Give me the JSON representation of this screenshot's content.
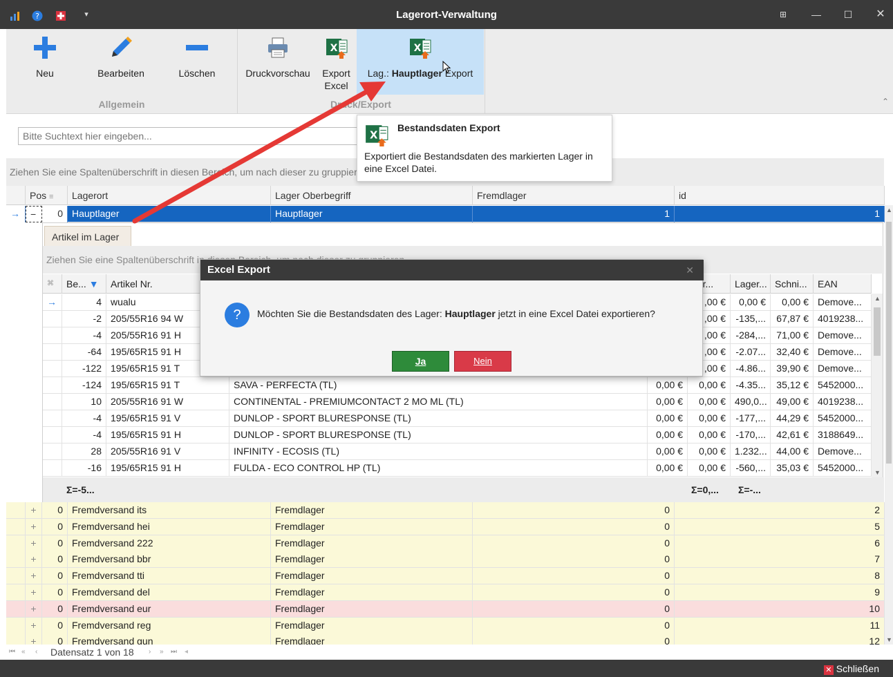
{
  "window": {
    "title": "Lagerort-Verwaltung"
  },
  "ribbon": {
    "new_label": "Neu",
    "edit_label": "Bearbeiten",
    "delete_label": "Löschen",
    "print_preview_label": "Druckvorschau",
    "export_excel_label_1": "Export",
    "export_excel_label_2": "Excel",
    "lag_export_prefix": "Lag.: ",
    "lag_export_name": "Hauptlager",
    "lag_export_suffix": " Export",
    "group_general": "Allgemein",
    "group_print_export": "Druck/Export"
  },
  "search": {
    "placeholder": "Bitte Suchtext hier eingeben..."
  },
  "grouping_hint": "Ziehen Sie eine Spaltenüberschrift in diesen Bereich, um nach dieser zu gruppieren",
  "grid": {
    "columns": [
      "Pos",
      "Lagerort",
      "Lager Oberbegriff",
      "Fremdlager",
      "id"
    ],
    "selected_row": {
      "toggle": "−",
      "pos": "0",
      "lagerort": "Hauptlager",
      "oberbegriff": "Hauptlager",
      "fremdlager": "1",
      "id": "1"
    },
    "rows": [
      {
        "toggle": "+",
        "pos": "0",
        "lagerort": "Fremdversand its",
        "oberbegriff": "Fremdlager",
        "fremdlager": "0",
        "id": "2"
      },
      {
        "toggle": "+",
        "pos": "0",
        "lagerort": "Fremdversand hei",
        "oberbegriff": "Fremdlager",
        "fremdlager": "0",
        "id": "5"
      },
      {
        "toggle": "+",
        "pos": "0",
        "lagerort": "Fremdversand 222",
        "oberbegriff": "Fremdlager",
        "fremdlager": "0",
        "id": "6"
      },
      {
        "toggle": "+",
        "pos": "0",
        "lagerort": "Fremdversand bbr",
        "oberbegriff": "Fremdlager",
        "fremdlager": "0",
        "id": "7"
      },
      {
        "toggle": "+",
        "pos": "0",
        "lagerort": "Fremdversand tti",
        "oberbegriff": "Fremdlager",
        "fremdlager": "0",
        "id": "8"
      },
      {
        "toggle": "+",
        "pos": "0",
        "lagerort": "Fremdversand del",
        "oberbegriff": "Fremdlager",
        "fremdlager": "0",
        "id": "9"
      },
      {
        "toggle": "+",
        "pos": "0",
        "lagerort": "Fremdversand eur",
        "oberbegriff": "Fremdlager",
        "fremdlager": "0",
        "id": "10"
      },
      {
        "toggle": "+",
        "pos": "0",
        "lagerort": "Fremdversand reg",
        "oberbegriff": "Fremdlager",
        "fremdlager": "0",
        "id": "11"
      },
      {
        "toggle": "+",
        "pos": "0",
        "lagerort": "Fremdversand gun",
        "oberbegriff": "Fremdlager",
        "fremdlager": "0",
        "id": "12"
      }
    ]
  },
  "detail": {
    "tab_label": "Artikel im Lager",
    "grouping_hint": "Ziehen Sie eine Spaltenüberschrift in diesen Bereich, um nach dieser zu gruppieren",
    "columns": [
      "Be...",
      "Artikel Nr.",
      "ger...",
      "Lager...",
      "Schni...",
      "EAN"
    ],
    "rows": [
      {
        "be": "4",
        "artnr": "wualu",
        "bez": "",
        "ek": "",
        "ger": ",00 €",
        "lager": "0,00 €",
        "schni": "0,00 €",
        "ean": "Demove..."
      },
      {
        "be": "-2",
        "artnr": "205/55R16 94 W",
        "bez": "",
        "ek": "",
        "ger": ",00 €",
        "lager": "-135,...",
        "schni": "67,87 €",
        "ean": "4019238..."
      },
      {
        "be": "-4",
        "artnr": "205/55R16 91 H",
        "bez": "",
        "ek": "",
        "ger": ",00 €",
        "lager": "-284,...",
        "schni": "71,00 €",
        "ean": "Demove..."
      },
      {
        "be": "-64",
        "artnr": "195/65R15 91 H",
        "bez": "",
        "ek": "",
        "ger": ",00 €",
        "lager": "-2.07...",
        "schni": "32,40 €",
        "ean": "Demove..."
      },
      {
        "be": "-122",
        "artnr": "195/65R15 91 T",
        "bez": "",
        "ek": "",
        "ger": ",00 €",
        "lager": "-4.86...",
        "schni": "39,90 €",
        "ean": "Demove..."
      },
      {
        "be": "-124",
        "artnr": "195/65R15 91 T",
        "bez": "SAVA - PERFECTA (TL)",
        "ek": "0,00 €",
        "ger": "0,00 €",
        "lager": "-4.35...",
        "schni": "35,12 €",
        "ean": "5452000..."
      },
      {
        "be": "10",
        "artnr": "205/55R16 91 W",
        "bez": "CONTINENTAL - PREMIUMCONTACT 2 MO ML (TL)",
        "ek": "0,00 €",
        "ger": "0,00 €",
        "lager": "490,0...",
        "schni": "49,00 €",
        "ean": "4019238..."
      },
      {
        "be": "-4",
        "artnr": "195/65R15 91 V",
        "bez": "DUNLOP - SPORT BLURESPONSE (TL)",
        "ek": "0,00 €",
        "ger": "0,00 €",
        "lager": "-177,...",
        "schni": "44,29 €",
        "ean": "5452000..."
      },
      {
        "be": "-4",
        "artnr": "195/65R15 91 H",
        "bez": "DUNLOP - SPORT BLURESPONSE (TL)",
        "ek": "0,00 €",
        "ger": "0,00 €",
        "lager": "-170,...",
        "schni": "42,61 €",
        "ean": "3188649..."
      },
      {
        "be": "28",
        "artnr": "205/55R16 91 V",
        "bez": "INFINITY - ECOSIS (TL)",
        "ek": "0,00 €",
        "ger": "0,00 €",
        "lager": "1.232...",
        "schni": "44,00 €",
        "ean": "Demove..."
      },
      {
        "be": "-16",
        "artnr": "195/65R15 91 H",
        "bez": "FULDA - ECO CONTROL HP (TL)",
        "ek": "0,00 €",
        "ger": "0,00 €",
        "lager": "-560,...",
        "schni": "35,03 €",
        "ean": "5452000..."
      }
    ],
    "sum_be": "Σ=-5...",
    "sum_ger": "Σ=0,...",
    "sum_lager": "Σ=-..."
  },
  "tooltip": {
    "title": "Bestandsdaten Export",
    "body": "Exportiert die Bestandsdaten des markierten Lager in eine Excel Datei."
  },
  "dialog": {
    "title": "Excel Export",
    "message_prefix": "Möchten Sie die Bestandsdaten des Lager: ",
    "message_bold": "Hauptlager",
    "message_suffix": " jetzt in eine Excel Datei exportieren?",
    "yes_label": "Ja",
    "no_label": "Nein"
  },
  "pager": {
    "record_text": "Datensatz 1 von 18"
  },
  "statusbar": {
    "close_label": "Schließen"
  },
  "colors": {
    "selection": "#1565c0",
    "ribbon_highlight": "#c6e1f8",
    "yes": "#2e8b3a",
    "no": "#d93a48",
    "arrow": "#e53935",
    "titlebar": "#3a3a3a"
  }
}
